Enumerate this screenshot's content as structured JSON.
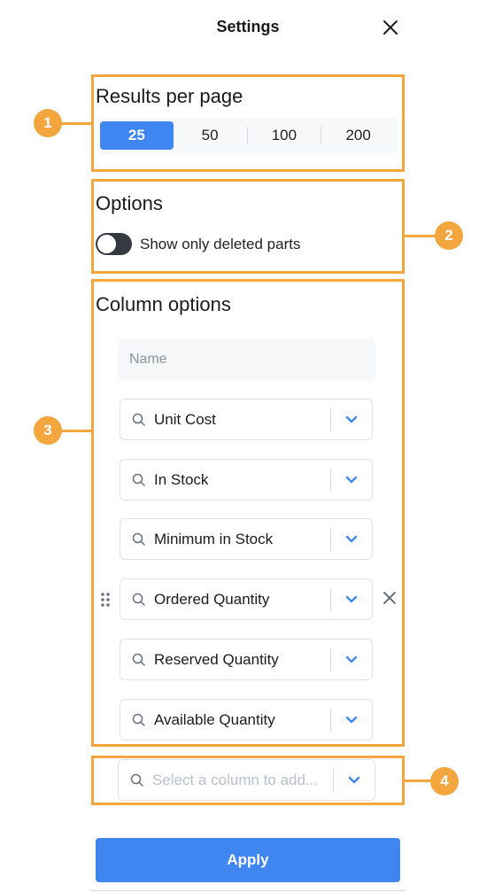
{
  "header": {
    "title": "Settings",
    "close_icon": "close-icon"
  },
  "annotations": [
    {
      "number": "1",
      "color": "#f3a53e"
    },
    {
      "number": "2",
      "color": "#f3a53e"
    },
    {
      "number": "3",
      "color": "#f3a53e"
    },
    {
      "number": "4",
      "color": "#f3a53e"
    }
  ],
  "results_per_page": {
    "title": "Results per page",
    "options": [
      "25",
      "50",
      "100",
      "200"
    ],
    "selected": "25",
    "accent": "#3f86f1"
  },
  "options": {
    "title": "Options",
    "toggle_label": "Show only deleted parts",
    "toggle_on": false
  },
  "column_options": {
    "title": "Column options",
    "fixed_column": "Name",
    "columns": [
      {
        "label": "Unit Cost"
      },
      {
        "label": "In Stock"
      },
      {
        "label": "Minimum in Stock"
      },
      {
        "label": "Ordered Quantity"
      },
      {
        "label": "Reserved Quantity"
      },
      {
        "label": "Available Quantity"
      }
    ],
    "add_placeholder": "Select a column to add..."
  },
  "footer": {
    "apply_label": "Apply"
  }
}
